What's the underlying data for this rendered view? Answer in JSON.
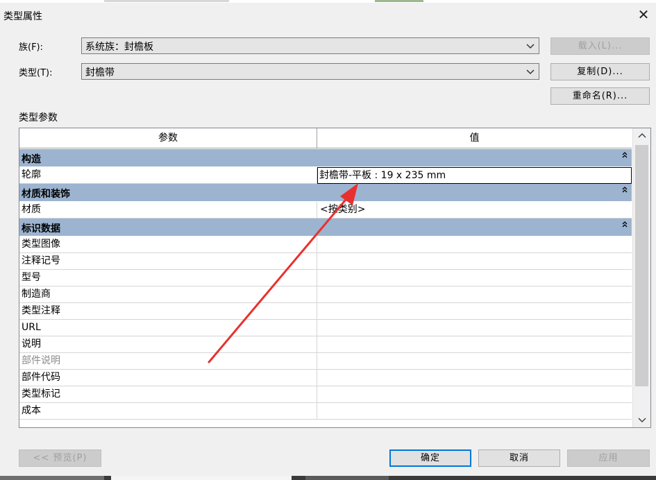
{
  "window": {
    "title": "类型属性",
    "close_glyph": "✕"
  },
  "family": {
    "label": "族(F):",
    "value": "系统族：封檐板"
  },
  "type": {
    "label": "类型(T):",
    "value": "封檐带"
  },
  "buttons": {
    "load": "载入(L)...",
    "duplicate": "复制(D)...",
    "rename": "重命名(R)...",
    "preview": "<< 预览(P)",
    "ok": "确定",
    "cancel": "取消",
    "apply": "应用"
  },
  "section_label": "类型参数",
  "table": {
    "headers": [
      "参数",
      "值"
    ],
    "groups": [
      {
        "name": "构造",
        "rows": [
          {
            "param": "轮廓",
            "value": "封檐带-平板 : 19 x 235 mm",
            "selected": true
          }
        ]
      },
      {
        "name": "材质和装饰",
        "rows": [
          {
            "param": "材质",
            "value": "<按类别>"
          }
        ]
      },
      {
        "name": "标识数据",
        "rows": [
          {
            "param": "类型图像",
            "value": ""
          },
          {
            "param": "注释记号",
            "value": ""
          },
          {
            "param": "型号",
            "value": ""
          },
          {
            "param": "制造商",
            "value": ""
          },
          {
            "param": "类型注释",
            "value": ""
          },
          {
            "param": "URL",
            "value": ""
          },
          {
            "param": "说明",
            "value": ""
          },
          {
            "param": "部件说明",
            "value": "",
            "dim": true
          },
          {
            "param": "部件代码",
            "value": ""
          },
          {
            "param": "类型标记",
            "value": ""
          },
          {
            "param": "成本",
            "value": ""
          }
        ]
      }
    ]
  },
  "colors": {
    "group_header": "#9cb4d0",
    "annotation_arrow": "#e8312f",
    "primary_border": "#0078d7"
  }
}
